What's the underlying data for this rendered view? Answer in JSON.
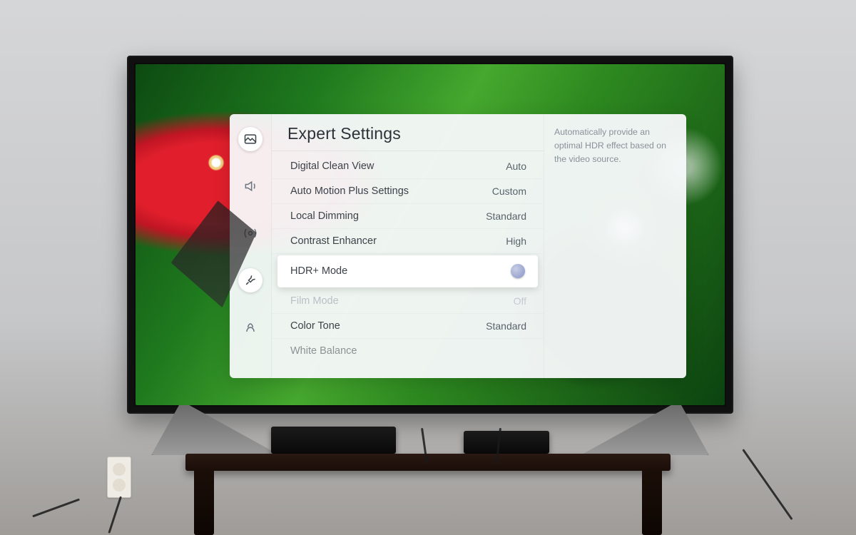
{
  "panel": {
    "title": "Expert Settings",
    "hint": "Automatically provide an optimal HDR effect based on the video source."
  },
  "sidebar": {
    "items": [
      {
        "name": "picture-icon",
        "active": true
      },
      {
        "name": "sound-icon",
        "active": false
      },
      {
        "name": "broadcast-icon",
        "active": false
      },
      {
        "name": "general-icon",
        "active": true
      },
      {
        "name": "support-icon",
        "active": false
      }
    ]
  },
  "rows": [
    {
      "label": "Digital Clean View",
      "value": "Auto"
    },
    {
      "label": "Auto Motion Plus Settings",
      "value": "Custom"
    },
    {
      "label": "Local Dimming",
      "value": "Standard"
    },
    {
      "label": "Contrast Enhancer",
      "value": "High"
    },
    {
      "label": "HDR+ Mode",
      "value": ""
    },
    {
      "label": "Film Mode",
      "value": "Off"
    },
    {
      "label": "Color Tone",
      "value": "Standard"
    },
    {
      "label": "White Balance",
      "value": ""
    }
  ]
}
